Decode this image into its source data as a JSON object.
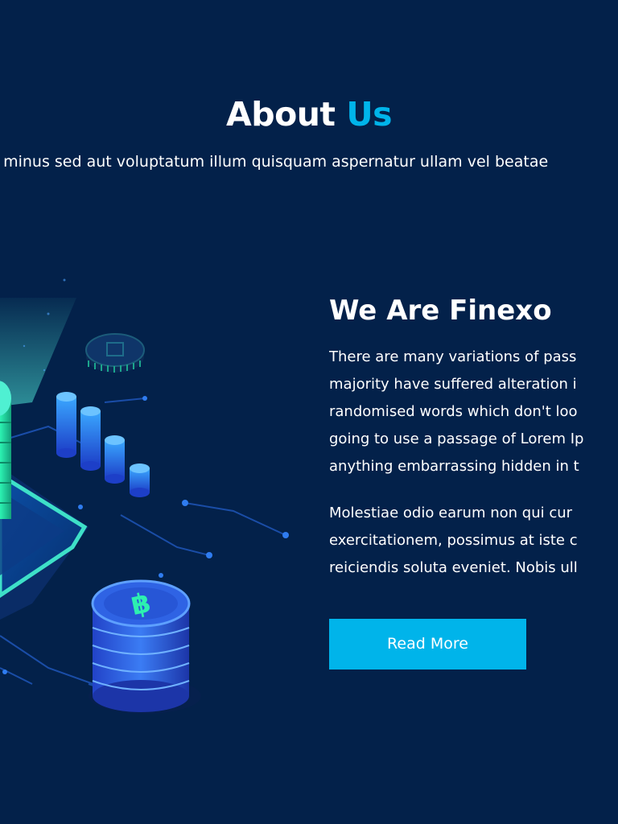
{
  "section": {
    "title_main": "About",
    "title_accent": "Us",
    "intro_text": "n minus sed aut voluptatum illum quisquam aspernatur ullam vel beatae"
  },
  "about": {
    "heading": "We Are Finexo",
    "paragraph_1_lines": [
      "There are many variations of pass",
      "majority have suffered alteration i",
      "randomised words which don't loo",
      "going to use a passage of Lorem Ip",
      "anything embarrassing hidden in t"
    ],
    "paragraph_2_lines": [
      "Molestiae odio earum non qui cur",
      "exercitationem, possimus at iste c",
      "reiciendis soluta eveniet. Nobis ull"
    ],
    "button_label": "Read More"
  },
  "illustration": {
    "icon": "crypto-server-coins-illustration",
    "coin_symbol": "฿"
  },
  "colors": {
    "background": "#03214a",
    "accent": "#00b4ea",
    "text": "#ffffff",
    "coin_green": "#1fd9a0",
    "coin_blue": "#2f6cf0"
  }
}
